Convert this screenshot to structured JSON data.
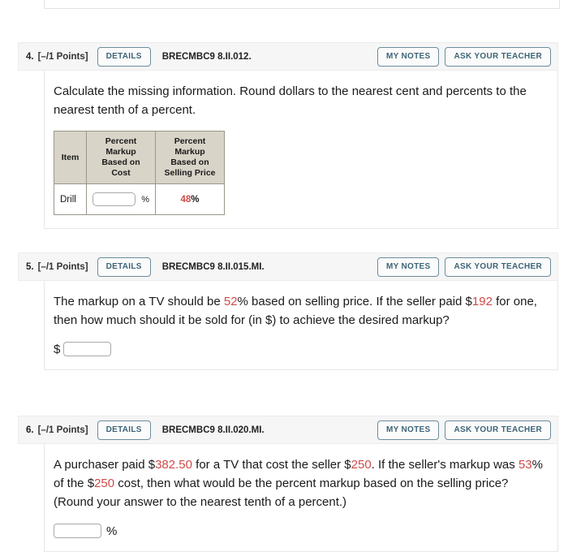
{
  "page": {
    "background": "#ffffff",
    "accent_button_color": "#3c6478",
    "accent_border_color": "#6d8c9c",
    "header_bg": "#f6f6f6",
    "highlight_number_color": "#cf4a47",
    "table_header_bg": "#d9d4c8"
  },
  "buttons": {
    "details_label": "DETAILS",
    "my_notes_label": "MY NOTES",
    "ask_your_teacher_label": "ASK YOUR TEACHER"
  },
  "questions": [
    {
      "number": "4.",
      "points": "[–/1 Points]",
      "code": "BRECMBC9 8.II.012.",
      "prompt_line1": "Calculate the missing information. Round dollars to the nearest cent and",
      "prompt_line2": "percents to the nearest tenth of a percent.",
      "table": {
        "headers": [
          "Item",
          "Percent Markup Based on Cost",
          "Percent Markup Based on Selling Price"
        ],
        "header_lines": [
          [
            "Item"
          ],
          [
            "Percent",
            "Markup",
            "Based on",
            "Cost"
          ],
          [
            "Percent",
            "Markup",
            "Based on",
            "Selling Price"
          ]
        ],
        "rows": [
          {
            "item": "Drill",
            "markup_on_cost": {
              "value": "",
              "placeholder": "",
              "suffix": "%",
              "is_input": true
            },
            "markup_on_selling_price": {
              "value": "48",
              "suffix": "%",
              "is_input": false,
              "color": "#cf4a47"
            }
          }
        ]
      }
    },
    {
      "number": "5.",
      "points": "[–/1 Points]",
      "code": "BRECMBC9 8.II.015.MI.",
      "prompt_segments": [
        {
          "text": "The markup on a TV should be ",
          "highlight": false
        },
        {
          "text": "52",
          "highlight": true
        },
        {
          "text": "% based on selling price. If the seller paid $",
          "highlight": false
        },
        {
          "text": "192",
          "highlight": true
        },
        {
          "text": " for one, then how much should it be sold for (in $) to achieve the desired markup?",
          "highlight": false
        }
      ],
      "answer": {
        "prefix": "$",
        "suffix": "",
        "value": "",
        "placeholder": ""
      }
    },
    {
      "number": "6.",
      "points": "[–/1 Points]",
      "code": "BRECMBC9 8.II.020.MI.",
      "prompt_segments": [
        {
          "text": "A purchaser paid $",
          "highlight": false
        },
        {
          "text": "382.50",
          "highlight": true
        },
        {
          "text": " for a TV that cost the seller $",
          "highlight": false
        },
        {
          "text": "250",
          "highlight": true
        },
        {
          "text": ". If the seller's markup was ",
          "highlight": false
        },
        {
          "text": "53",
          "highlight": true
        },
        {
          "text": "% of the $",
          "highlight": false
        },
        {
          "text": "250",
          "highlight": true
        },
        {
          "text": " cost, then what would be the percent markup based on the selling price? (Round your answer to the nearest tenth of a percent.)",
          "highlight": false
        }
      ],
      "answer": {
        "prefix": "",
        "suffix": "%",
        "value": "",
        "placeholder": ""
      }
    }
  ]
}
